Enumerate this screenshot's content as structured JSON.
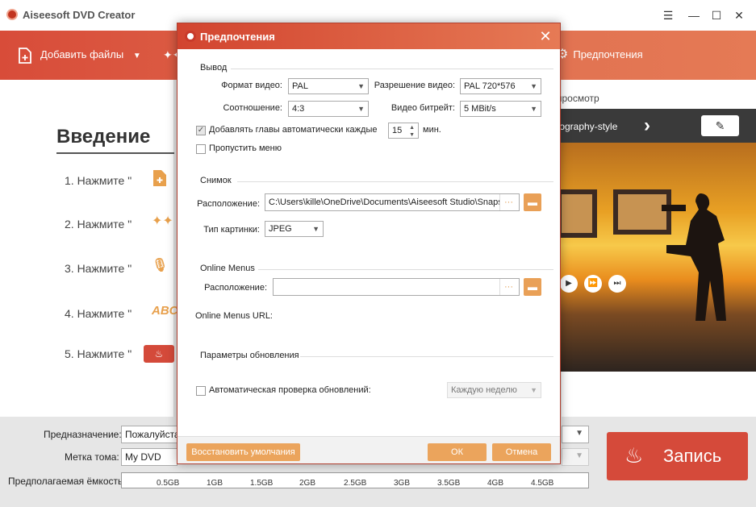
{
  "app": {
    "title": "Aiseesoft DVD Creator"
  },
  "toolbar": {
    "add_files": "Добавить файлы",
    "preferences": "Предпочтения"
  },
  "intro": {
    "title": "Введение",
    "steps": [
      "1. Нажмите \"",
      "2. Нажмите \"",
      "3. Нажмите \"",
      "4. Нажмите \"",
      "5. Нажмите \""
    ]
  },
  "preview": {
    "label": "просмотр",
    "theme_name": "tography-style"
  },
  "bottom": {
    "destination_label": "Предназначение:",
    "destination_value": "Пожалуйста,",
    "volume_label": "Метка тома:",
    "volume_value": "My DVD",
    "capacity_label": "Предполагаемая ёмкость:",
    "capacity_ticks": [
      "0.5GB",
      "1GB",
      "1.5GB",
      "2GB",
      "2.5GB",
      "3GB",
      "3.5GB",
      "4GB",
      "4.5GB"
    ],
    "burn_label": "Запись"
  },
  "dialog": {
    "title": "Предпочтения",
    "output": {
      "section": "Вывод",
      "video_format_label": "Формат видео:",
      "video_format_value": "PAL",
      "resolution_label": "Разрешение видео:",
      "resolution_value": "PAL 720*576",
      "aspect_label": "Соотношение:",
      "aspect_value": "4:3",
      "bitrate_label": "Видео битрейт:",
      "bitrate_value": "5 MBit/s",
      "auto_chapters_label": "Добавлять главы автоматически каждые",
      "auto_chapters_value": "15",
      "auto_chapters_unit": "мин.",
      "skip_menu_label": "Пропустить меню"
    },
    "snapshot": {
      "section": "Снимок",
      "location_label": "Расположение:",
      "location_value": "C:\\Users\\kille\\OneDrive\\Documents\\Aiseesoft Studio\\Snapshot",
      "image_type_label": "Тип картинки:",
      "image_type_value": "JPEG"
    },
    "online_menus": {
      "section": "Online Menus",
      "location_label": "Расположение:",
      "location_value": "",
      "url_label": "Online Menus URL:"
    },
    "updates": {
      "section": "Параметры обновления",
      "auto_check_label": "Автоматическая проверка обновлений:",
      "frequency_value": "Каждую неделю"
    },
    "footer": {
      "restore": "Восстановить умолчания",
      "ok": "ОК",
      "cancel": "Отмена"
    }
  },
  "colors": {
    "accent": "#d84c39",
    "orange_button": "#eba45c",
    "burn": "#d54a3a"
  }
}
